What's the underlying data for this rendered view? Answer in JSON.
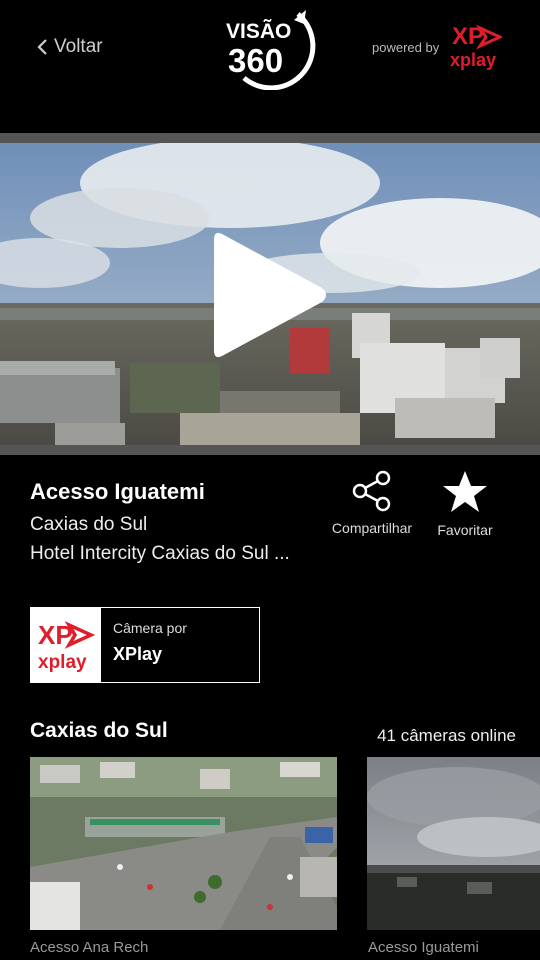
{
  "header": {
    "back_label": "Voltar",
    "logo_text_top": "VISÃO",
    "logo_text_bottom": "360",
    "powered_by": "powered by",
    "brand_xp": "XP",
    "brand_name": "xplay",
    "accent_color": "#e01e2b"
  },
  "player": {
    "state": "paused",
    "play_icon": "play-icon"
  },
  "camera": {
    "title": "Acesso Iguatemi",
    "city": "Caxias do Sul",
    "location": "Hotel Intercity Caxias do Sul ...",
    "share_label": "Compartilhar",
    "favorite_label": "Favoritar"
  },
  "provider": {
    "subtitle": "Câmera por",
    "name": "XPlay",
    "logo_xp": "XP",
    "logo_name": "xplay"
  },
  "section": {
    "title": "Caxias do Sul",
    "online_count": "41 câmeras online",
    "cameras": [
      {
        "label": "Acesso Ana Rech"
      },
      {
        "label": "Acesso Iguatemi"
      }
    ]
  }
}
